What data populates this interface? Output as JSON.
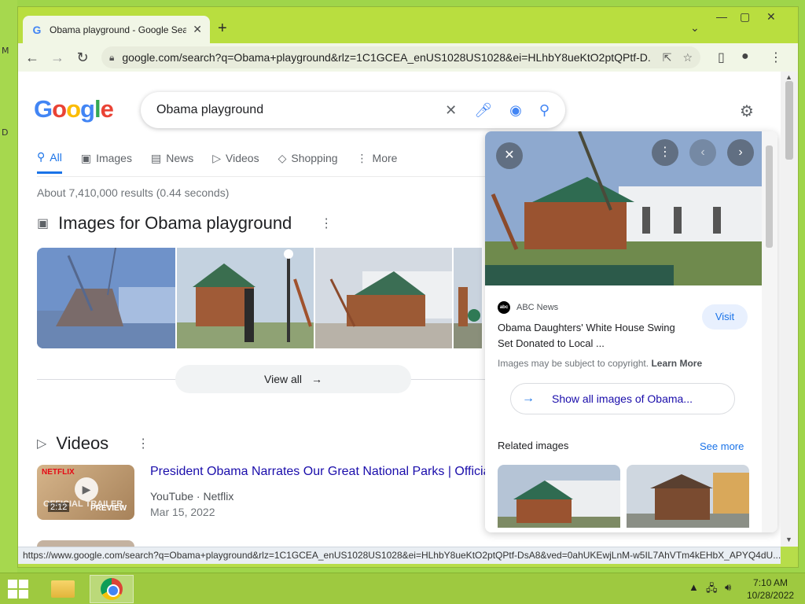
{
  "desktop": {
    "glyph_top": "M",
    "glyph_bottom": "D"
  },
  "browser": {
    "tab_title": "Obama playground - Google Sea",
    "url": "google.com/search?q=Obama+playground&rlz=1C1GCEA_enUS1028US1028&ei=HLhbY8ueKtO2ptQPtf-D...",
    "status_url": "https://www.google.com/search?q=Obama+playground&rlz=1C1GCEA_enUS1028US1028&ei=HLhbY8ueKtO2ptQPtf-DsA8&ved=0ahUKEwjLnM-w5IL7AhVTm4kEHbX_APYQ4dU..."
  },
  "search": {
    "logo": [
      "G",
      "o",
      "o",
      "g",
      "l",
      "e"
    ],
    "query": "Obama playground",
    "tabs": [
      {
        "label": "All",
        "icon": "search-icon",
        "active": true
      },
      {
        "label": "Images",
        "icon": "image-icon"
      },
      {
        "label": "News",
        "icon": "news-icon"
      },
      {
        "label": "Videos",
        "icon": "video-icon"
      },
      {
        "label": "Shopping",
        "icon": "tag-icon"
      },
      {
        "label": "More",
        "icon": "more-vert-icon"
      }
    ],
    "stats": "About 7,410,000 results (0.44 seconds)"
  },
  "images_section": {
    "title": "Images for Obama playground",
    "view_all": "View all"
  },
  "videos_section": {
    "title": "Videos",
    "items": [
      {
        "title": "President Obama Narrates Our Great National Parks | Official",
        "source": "YouTube · Netflix",
        "date": "Mar 15, 2022",
        "duration": "2:12",
        "badge": "NETFLIX",
        "overlay": "OFFICIAL TRAILER",
        "preview": "PREVIEW"
      }
    ]
  },
  "side_panel": {
    "source": "ABC News",
    "source_logo": "abc",
    "title": "Obama Daughters' White House Swing Set Donated to Local ...",
    "visit": "Visit",
    "copyright": "Images may be subject to copyright.",
    "learn_more": "Learn More",
    "show_all": "Show all images of Obama...",
    "related": "Related images",
    "see_more": "See more"
  },
  "taskbar": {
    "time": "7:10 AM",
    "date": "10/28/2022"
  }
}
